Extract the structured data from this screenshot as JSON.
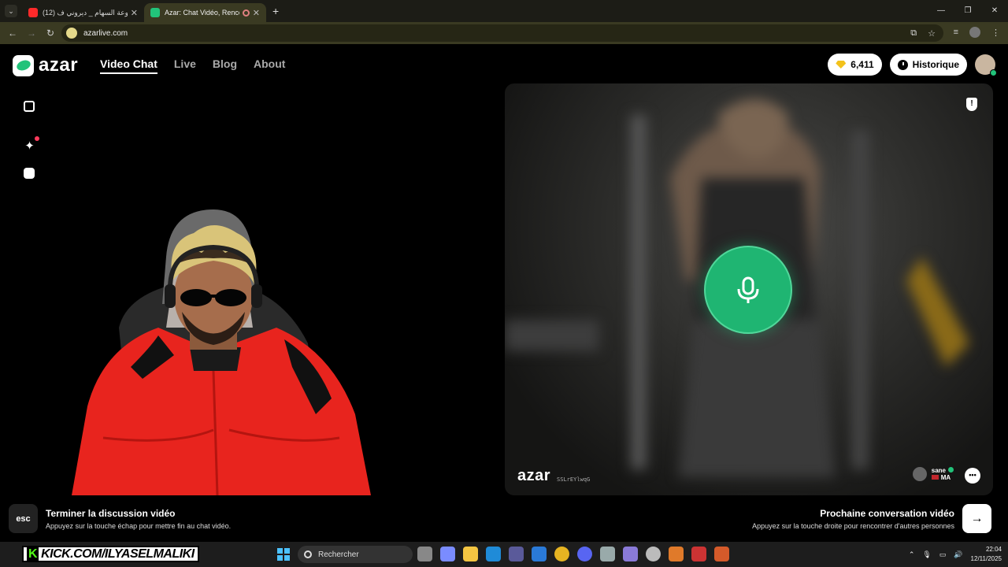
{
  "browser": {
    "tabs": [
      {
        "title": "(12) مجموعة السهام _ ديروني ف...",
        "active": false
      },
      {
        "title": "Azar: Chat Vidéo, Rencontre...",
        "active": true
      }
    ],
    "url": "azarlive.com",
    "new_tab": "+",
    "window_controls": [
      "—",
      "❐",
      "✕"
    ]
  },
  "site": {
    "logo": "azar",
    "nav": [
      "Video Chat",
      "Live",
      "Blog",
      "About"
    ],
    "gems": "6,411",
    "history": "Historique"
  },
  "partner": {
    "watermark": "azar",
    "code": "SSLrEYlwqG",
    "name": "sane",
    "country": "MA"
  },
  "bottom": {
    "esc_key": "esc",
    "end_title": "Terminer la discussion vidéo",
    "end_sub": "Appuyez sur la touche échap pour mettre fin au chat vidéo.",
    "next_title": "Prochaine conversation vidéo",
    "next_sub": "Appuyez sur la touche droite pour rencontrer d'autres personnes",
    "next_arrow": "→"
  },
  "taskbar": {
    "kick_text": "KICK.COM/ILYASELMALIKI",
    "search_placeholder": "Rechercher",
    "time": "22:04",
    "date": "12/11/2025"
  },
  "colors": {
    "brand_green": "#22c37a",
    "mic_green": "#1fb572",
    "tab_active": "#3a3a22"
  }
}
